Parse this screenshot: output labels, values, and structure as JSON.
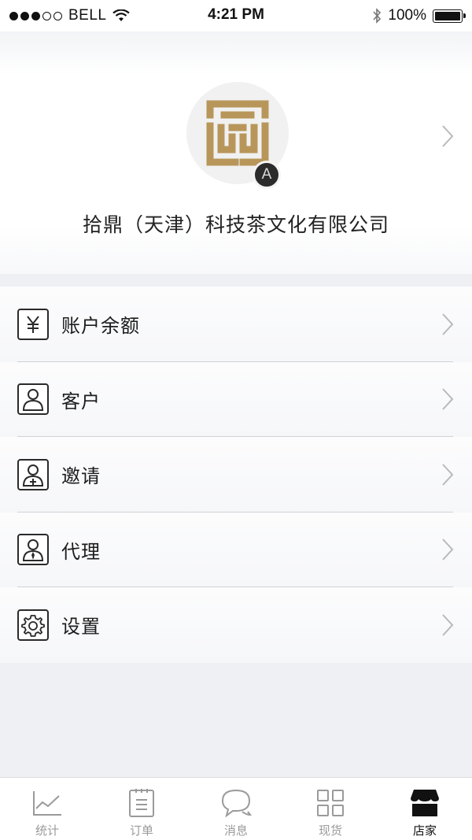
{
  "status_bar": {
    "carrier": "BELL",
    "time": "4:21 PM",
    "battery": "100%",
    "signal_bars_filled": 3,
    "signal_bars_total": 5
  },
  "profile": {
    "avatar_badge": "A",
    "company_name": "拾鼎（天津）科技茶文化有限公司"
  },
  "menu": {
    "items": [
      {
        "label": "账户余额",
        "icon": "yuan-icon"
      },
      {
        "label": "客户",
        "icon": "user-icon"
      },
      {
        "label": "邀请",
        "icon": "invite-user-icon"
      },
      {
        "label": "代理",
        "icon": "agent-icon"
      },
      {
        "label": "设置",
        "icon": "gear-icon"
      }
    ]
  },
  "tabbar": {
    "tabs": [
      {
        "label": "统计",
        "icon": "chart-icon",
        "active": false
      },
      {
        "label": "订单",
        "icon": "order-icon",
        "active": false
      },
      {
        "label": "消息",
        "icon": "message-icon",
        "active": false
      },
      {
        "label": "现货",
        "icon": "grid-icon",
        "active": false
      },
      {
        "label": "店家",
        "icon": "store-icon",
        "active": true
      }
    ]
  },
  "colors": {
    "logo_gold": "#b8965a",
    "tab_inactive": "#9a9a9a",
    "tab_active": "#111111",
    "background": "#eef0f4"
  }
}
